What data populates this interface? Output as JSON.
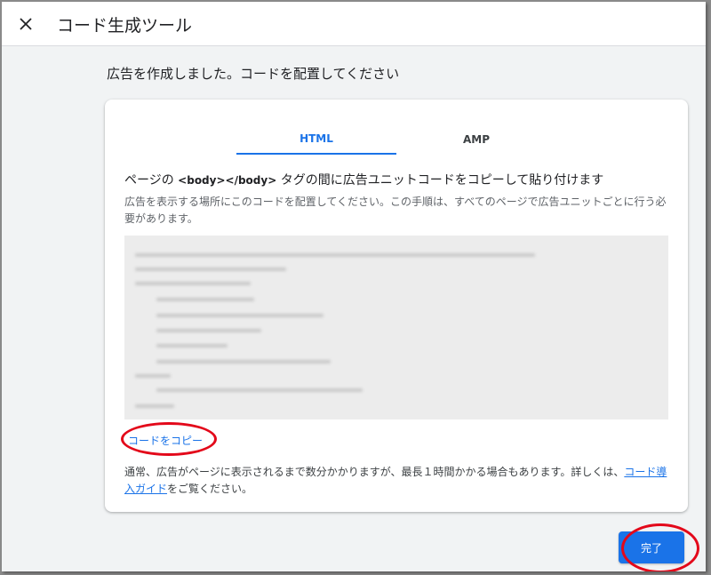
{
  "dialog": {
    "title": "コード生成ツール",
    "close_icon": "close-icon"
  },
  "page": {
    "heading": "広告を作成しました。コードを配置してください"
  },
  "tabs": [
    {
      "label": "HTML",
      "selected": true
    },
    {
      "label": "AMP",
      "selected": false
    }
  ],
  "instructions": {
    "title_prefix": "ページの ",
    "title_tag": "<body></body>",
    "title_suffix": " タグの間に広告ユニットコードをコピーして貼り付けます",
    "description": "広告を表示する場所にこのコードを配置してください。この手順は、すべてのページで広告ユニットごとに行う必要があります。"
  },
  "copy_link": "コードをコピー",
  "footer": {
    "note": "通常、広告がページに表示されるまで数分かかりますが、最長１時間かかる場合もあります。詳しくは、",
    "link": "コード導入ガイド",
    "note_suffix": "をご覧ください。"
  },
  "done_button": "完了",
  "colors": {
    "accent": "#1a73e8",
    "annotation": "#e3081a"
  }
}
